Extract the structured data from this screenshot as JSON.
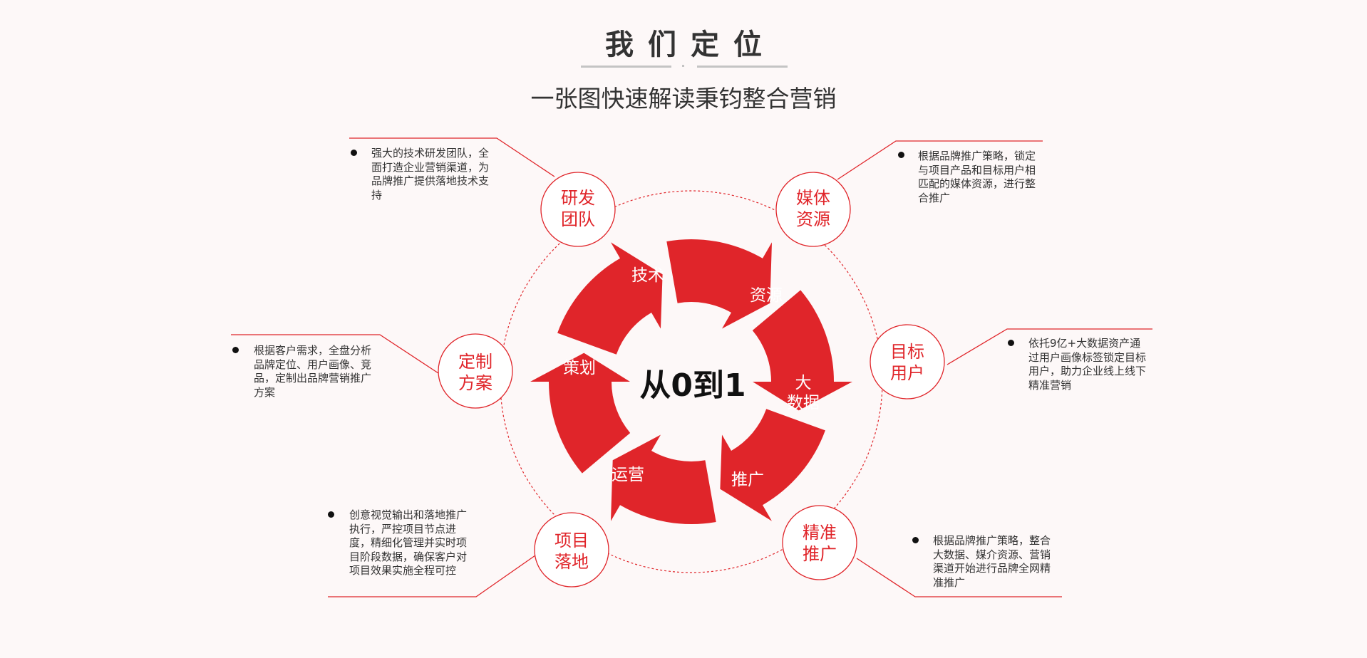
{
  "header": {
    "title": "我们定位",
    "subtitle": "一张图快速解读秉钧整合营销"
  },
  "center": {
    "label": "从0到1"
  },
  "cycle": [
    {
      "id": "jishu",
      "label": "技术"
    },
    {
      "id": "ziyuan",
      "label": "资源"
    },
    {
      "id": "dashuju",
      "label_lines": [
        "大",
        "数据"
      ]
    },
    {
      "id": "tuiguang",
      "label": "推广"
    },
    {
      "id": "yunying",
      "label": "运营"
    },
    {
      "id": "cehua",
      "label": "策划"
    }
  ],
  "nodes": [
    {
      "id": "yanfa",
      "label_lines": [
        "研发",
        "团队"
      ],
      "desc": "强大的技术研发团队，全面打造企业营销渠道，为品牌推广提供落地技术支持"
    },
    {
      "id": "meiti",
      "label_lines": [
        "媒体",
        "资源"
      ],
      "desc": "根据品牌推广策略，锁定与项目产品和目标用户相匹配的媒体资源，进行整合推广"
    },
    {
      "id": "mubiao",
      "label_lines": [
        "目标",
        "用户"
      ],
      "desc": "依托9亿+大数据资产通过用户画像标签锁定目标用户，助力企业线上线下精准营销"
    },
    {
      "id": "jingzhun",
      "label_lines": [
        "精准",
        "推广"
      ],
      "desc": "根据品牌推广策略，整合大数据、媒介资源、营销渠道开始进行品牌全网精准推广"
    },
    {
      "id": "xiangmu",
      "label_lines": [
        "项目",
        "落地"
      ],
      "desc": "创意视觉输出和落地推广执行，严控项目节点进度，精细化管理并实时项目阶段数据，确保客户对项目效果实施全程可控"
    },
    {
      "id": "dingzhi",
      "label_lines": [
        "定制",
        "方案"
      ],
      "desc": "根据客户需求，全盘分析品牌定位、用户画像、竞品，定制出品牌营销推广方案"
    }
  ],
  "colors": {
    "accent": "#e0252a",
    "text": "#333333",
    "background": "#fdf8f8"
  }
}
